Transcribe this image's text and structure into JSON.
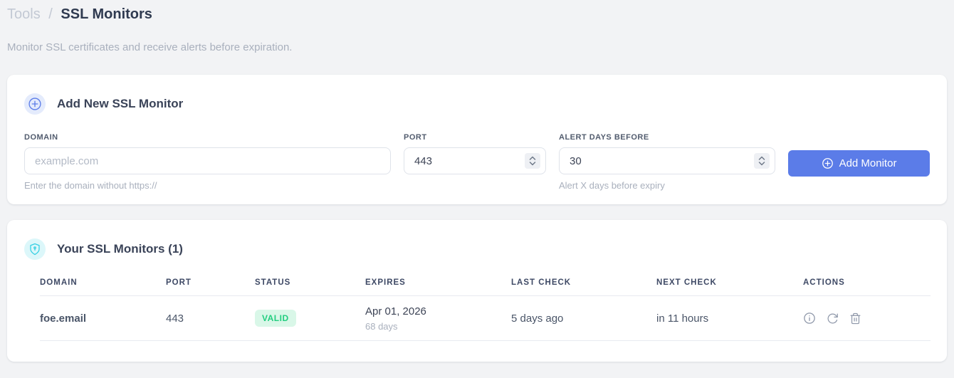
{
  "page": {
    "breadcrumb": {
      "parent": "Tools",
      "separator": "/",
      "current": "SSL Monitors"
    },
    "subtitle": "Monitor SSL certificates and receive alerts before expiration."
  },
  "add_monitor_card": {
    "title": "Add New SSL Monitor",
    "icon": "plus-circle-icon",
    "fields": {
      "domain": {
        "label": "DOMAIN",
        "placeholder": "example.com",
        "value": "",
        "helper": "Enter the domain without https://"
      },
      "port": {
        "label": "PORT",
        "value": "443"
      },
      "alert_days": {
        "label": "ALERT DAYS BEFORE",
        "value": "30",
        "helper": "Alert X days before expiry"
      }
    },
    "submit_label": "Add Monitor"
  },
  "monitors_card": {
    "title": "Your SSL Monitors (1)",
    "icon": "shield-icon",
    "count": 1,
    "table": {
      "headers": [
        "DOMAIN",
        "PORT",
        "STATUS",
        "EXPIRES",
        "LAST CHECK",
        "NEXT CHECK",
        "ACTIONS"
      ],
      "rows": [
        {
          "domain": "foe.email",
          "port": "443",
          "status": "VALID",
          "expires_date": "Apr 01, 2026",
          "expires_days": "68 days",
          "last_check": "5 days ago",
          "next_check": "in 11 hours",
          "actions": [
            "info",
            "refresh",
            "delete"
          ]
        }
      ]
    }
  },
  "colors": {
    "accent_blue": "#5b7ce8",
    "link_blue": "#4d7df0",
    "valid_text": "#23ce80",
    "valid_bg": "#d9f7e8",
    "shield_cyan": "#35cfe3",
    "page_bg": "#f2f3f5"
  }
}
